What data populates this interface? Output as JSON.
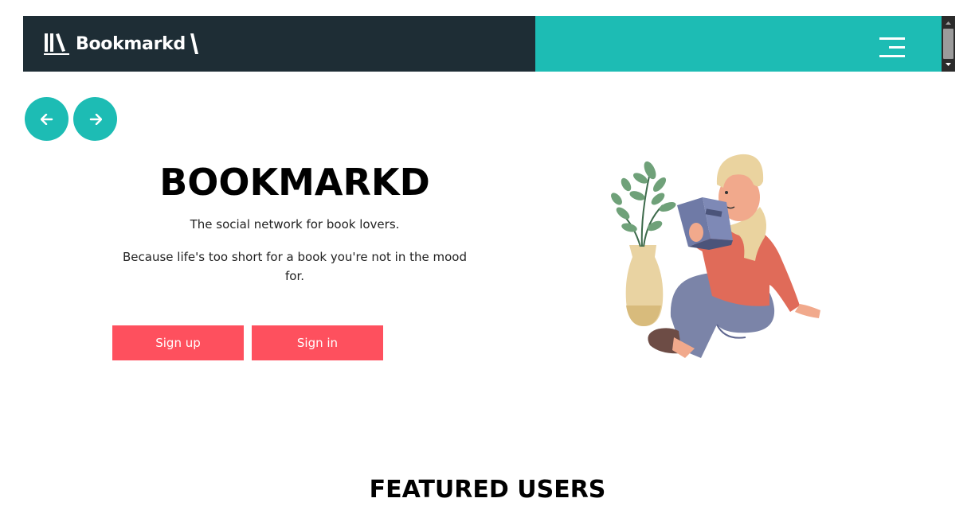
{
  "header": {
    "brand": "Bookmarkd",
    "colors": {
      "dark": "#1e2d35",
      "teal": "#1dbcb4"
    },
    "menu_icon": "hamburger-icon",
    "logo_icon": "books-icon"
  },
  "carousel": {
    "prev_icon": "arrow-left-icon",
    "next_icon": "arrow-right-icon"
  },
  "hero": {
    "title": "BOOKMARKD",
    "tagline": "The social network for book lovers.",
    "subline": "Because life's too short for a book you're not in the mood for.",
    "signup_label": "Sign up",
    "signin_label": "Sign in",
    "button_color": "#fe505e",
    "illustration": "person-reading-illustration"
  },
  "sections": {
    "featured_title": "FEATURED USERS"
  }
}
